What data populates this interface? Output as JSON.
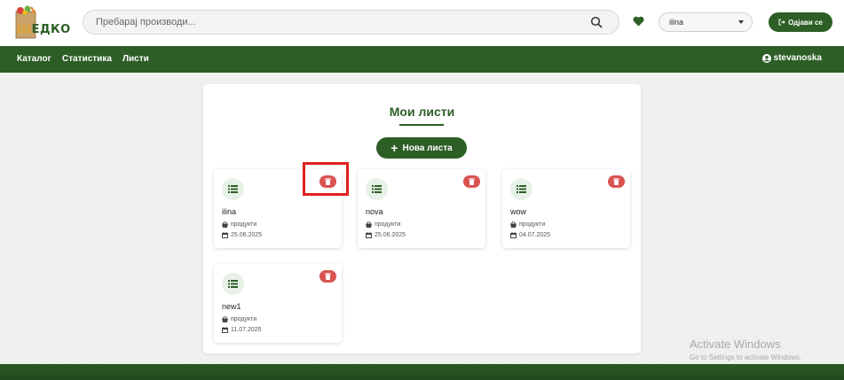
{
  "logo": {
    "text_prefix": "Ш",
    "text_rest": "ЕДКО"
  },
  "search": {
    "placeholder": "Пребарај производи..."
  },
  "user_select": {
    "value": "ilina"
  },
  "header": {
    "logout_label": "Одјави се"
  },
  "nav": {
    "items": [
      "Каталог",
      "Статистика",
      "Листи"
    ],
    "user": "stevanoska"
  },
  "panel": {
    "title": "Мои листи",
    "new_list_label": "Нова листа"
  },
  "lists": [
    {
      "name": "ilina",
      "products": "продукти",
      "date": "25.06.2025"
    },
    {
      "name": "nova",
      "products": "продукти",
      "date": "25.06.2025"
    },
    {
      "name": "wow",
      "products": "продукти",
      "date": "04.07.2025"
    },
    {
      "name": "new1",
      "products": "продукти",
      "date": "11.07.2025"
    }
  ],
  "watermark": {
    "title": "Activate Windows",
    "subtitle": "Go to Settings to activate Windows."
  },
  "colors": {
    "primary": "#2d5e26",
    "danger": "#d9534f",
    "highlight": "#e0201e",
    "background": "#efefef"
  },
  "icons": [
    "search-icon",
    "heart-icon",
    "chevron-down-icon",
    "logout-icon",
    "user-icon",
    "plus-icon",
    "list-icon",
    "trash-icon",
    "basket-icon",
    "calendar-icon"
  ]
}
